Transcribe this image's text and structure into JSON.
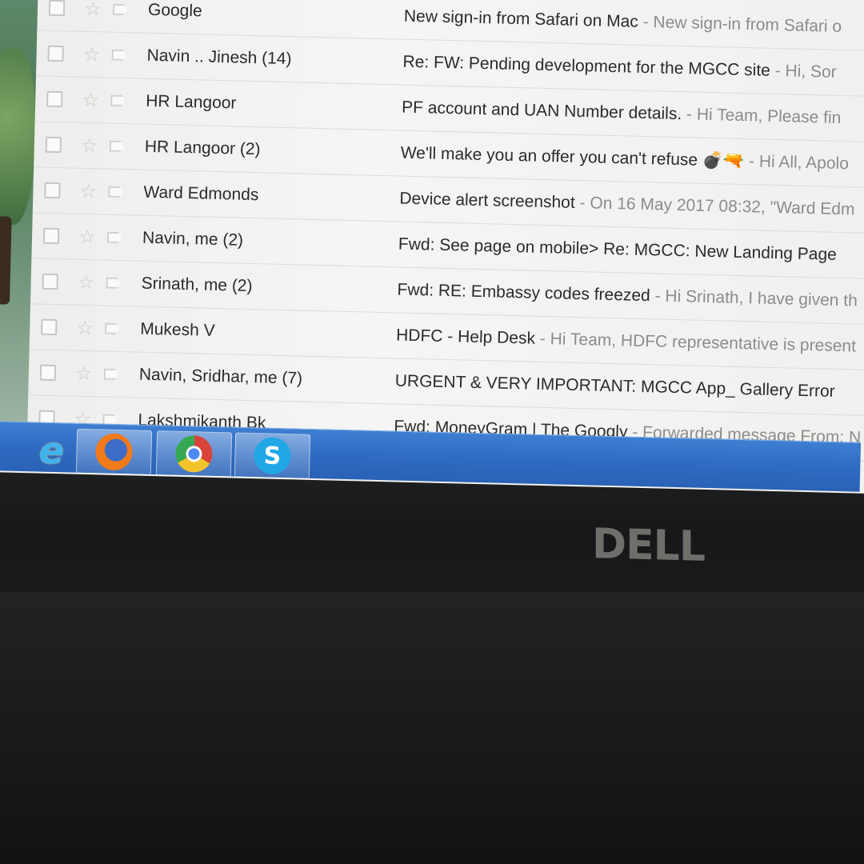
{
  "emails": [
    {
      "sender": "Google",
      "subject": "New sign-in from Safari on Mac",
      "snippet": "New sign-in from Safari o"
    },
    {
      "sender": "Navin .. Jinesh (14)",
      "subject": "Re: FW: Pending development for the MGCC site",
      "snippet": "Hi, Sor"
    },
    {
      "sender": "HR Langoor",
      "subject": "PF account and UAN Number details.",
      "snippet": "Hi Team, Please fin"
    },
    {
      "sender": "HR Langoor (2)",
      "subject": "We'll make you an offer you can't refuse 💣🔫",
      "snippet": "Hi All, Apolo"
    },
    {
      "sender": "Ward Edmonds",
      "subject": "Device alert screenshot",
      "snippet": "On 16 May 2017 08:32, \"Ward Edm"
    },
    {
      "sender": "Navin, me (2)",
      "subject": "Fwd: See page on mobile> Re: MGCC: New Landing Page",
      "snippet": ""
    },
    {
      "sender": "Srinath, me (2)",
      "subject": "Fwd: RE: Embassy codes freezed",
      "snippet": "Hi Srinath, I have given th"
    },
    {
      "sender": "Mukesh V",
      "subject": "HDFC - Help Desk",
      "snippet": "Hi Team, HDFC representative is present"
    },
    {
      "sender": "Navin, Sridhar, me (7)",
      "subject": "URGENT & VERY IMPORTANT: MGCC App_ Gallery Error",
      "snippet": ""
    },
    {
      "sender": "Lakshmikanth Bk",
      "subject": "Fwd: MoneyGram | The Googly",
      "snippet": "Forwarded message From: N"
    }
  ],
  "taskbar": {
    "apps": [
      {
        "name": "Internet Explorer",
        "icon": "ie-icon",
        "glyph": "e",
        "active": false
      },
      {
        "name": "Firefox",
        "icon": "firefox-icon",
        "active": true
      },
      {
        "name": "Chrome",
        "icon": "chrome-icon",
        "active": true
      },
      {
        "name": "Skype",
        "icon": "skype-icon",
        "glyph": "S",
        "active": true
      }
    ],
    "color": "#2e6bc2"
  },
  "laptop": {
    "brand": "DELL"
  },
  "icons": {
    "star": "☆"
  }
}
